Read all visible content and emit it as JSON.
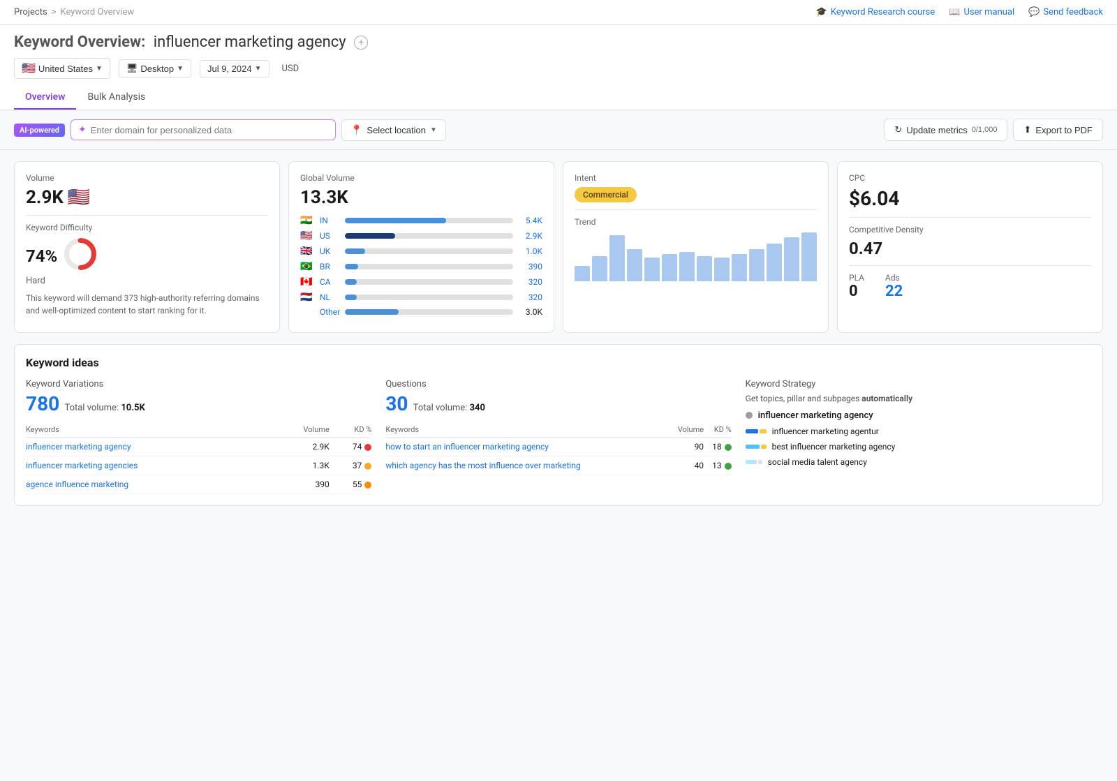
{
  "breadcrumb": {
    "projects": "Projects",
    "separator": ">",
    "current": "Keyword Overview"
  },
  "topnav": {
    "course_link": "Keyword Research course",
    "manual_link": "User manual",
    "feedback_link": "Send feedback"
  },
  "header": {
    "title_prefix": "Keyword Overview:",
    "keyword": "influencer marketing agency",
    "add_tooltip": "+"
  },
  "filters": {
    "location": "United States",
    "device": "Desktop",
    "date": "Jul 9, 2024",
    "currency": "USD"
  },
  "tabs": [
    {
      "id": "overview",
      "label": "Overview",
      "active": true
    },
    {
      "id": "bulk",
      "label": "Bulk Analysis",
      "active": false
    }
  ],
  "toolbar": {
    "ai_badge": "AI-powered",
    "domain_placeholder": "Enter domain for personalized data",
    "select_location": "Select location",
    "update_btn": "Update metrics",
    "counter": "0/1,000",
    "export_btn": "Export to PDF"
  },
  "volume_card": {
    "label": "Volume",
    "value": "2.9K",
    "kd_label": "Keyword Difficulty",
    "kd_value": "74%",
    "kd_category": "Hard",
    "kd_donut_pct": 74,
    "description": "This keyword will demand 373 high-authority referring domains and well-optimized content to start ranking for it."
  },
  "global_volume_card": {
    "label": "Global Volume",
    "value": "13.3K",
    "rows": [
      {
        "flag": "🇮🇳",
        "code": "IN",
        "bar_pct": 60,
        "value": "5.4K"
      },
      {
        "flag": "🇺🇸",
        "code": "US",
        "bar_pct": 30,
        "value": "2.9K"
      },
      {
        "flag": "🇬🇧",
        "code": "UK",
        "bar_pct": 12,
        "value": "1.0K"
      },
      {
        "flag": "🇧🇷",
        "code": "BR",
        "bar_pct": 8,
        "value": "390"
      },
      {
        "flag": "🇨🇦",
        "code": "CA",
        "bar_pct": 7,
        "value": "320"
      },
      {
        "flag": "🇳🇱",
        "code": "NL",
        "bar_pct": 7,
        "value": "320"
      },
      {
        "flag": "",
        "code": "",
        "label": "Other",
        "bar_pct": 32,
        "value": "3.0K"
      }
    ]
  },
  "intent_trend_card": {
    "intent_label": "Intent",
    "intent_value": "Commercial",
    "trend_label": "Trend",
    "trend_bars": [
      18,
      30,
      55,
      38,
      28,
      32,
      35,
      30,
      28,
      32,
      38,
      45,
      52,
      58
    ]
  },
  "cpc_card": {
    "cpc_label": "CPC",
    "cpc_value": "$6.04",
    "cd_label": "Competitive Density",
    "cd_value": "0.47",
    "pla_label": "PLA",
    "pla_value": "0",
    "ads_label": "Ads",
    "ads_value": "22"
  },
  "ideas": {
    "title": "Keyword ideas",
    "variations": {
      "title": "Keyword Variations",
      "count": "780",
      "volume_prefix": "Total volume:",
      "volume": "10.5K",
      "col_keywords": "Keywords",
      "col_volume": "Volume",
      "col_kd": "KD %",
      "rows": [
        {
          "kw": "influencer marketing agency",
          "volume": "2.9K",
          "kd": "74",
          "dot": "red"
        },
        {
          "kw": "influencer marketing agencies",
          "volume": "1.3K",
          "kd": "37",
          "dot": "yellow"
        },
        {
          "kw": "agence influence marketing",
          "volume": "390",
          "kd": "55",
          "dot": "orange"
        }
      ]
    },
    "questions": {
      "title": "Questions",
      "count": "30",
      "volume_prefix": "Total volume:",
      "volume": "340",
      "col_keywords": "Keywords",
      "col_volume": "Volume",
      "col_kd": "KD %",
      "rows": [
        {
          "kw": "how to start an influencer marketing agency",
          "volume": "90",
          "kd": "18",
          "dot": "green"
        },
        {
          "kw": "which agency has the most influence over marketing",
          "volume": "40",
          "kd": "13",
          "dot": "green"
        }
      ]
    },
    "strategy": {
      "title": "Keyword Strategy",
      "description": "Get topics, pillar and subpages automatically",
      "root": "influencer marketing agency",
      "items": [
        {
          "label": "influencer marketing agentur",
          "bars": [
            {
              "color": "#1a73e8",
              "width": 18
            },
            {
              "color": "#f5c842",
              "width": 10
            }
          ]
        },
        {
          "label": "best influencer marketing agency",
          "bars": [
            {
              "color": "#4fc3f7",
              "width": 20
            },
            {
              "color": "#f5c842",
              "width": 8
            }
          ]
        },
        {
          "label": "social media talent agency",
          "bars": [
            {
              "color": "#b3e5fc",
              "width": 16
            },
            {
              "color": "#e0e0e0",
              "width": 6
            }
          ]
        }
      ]
    }
  }
}
